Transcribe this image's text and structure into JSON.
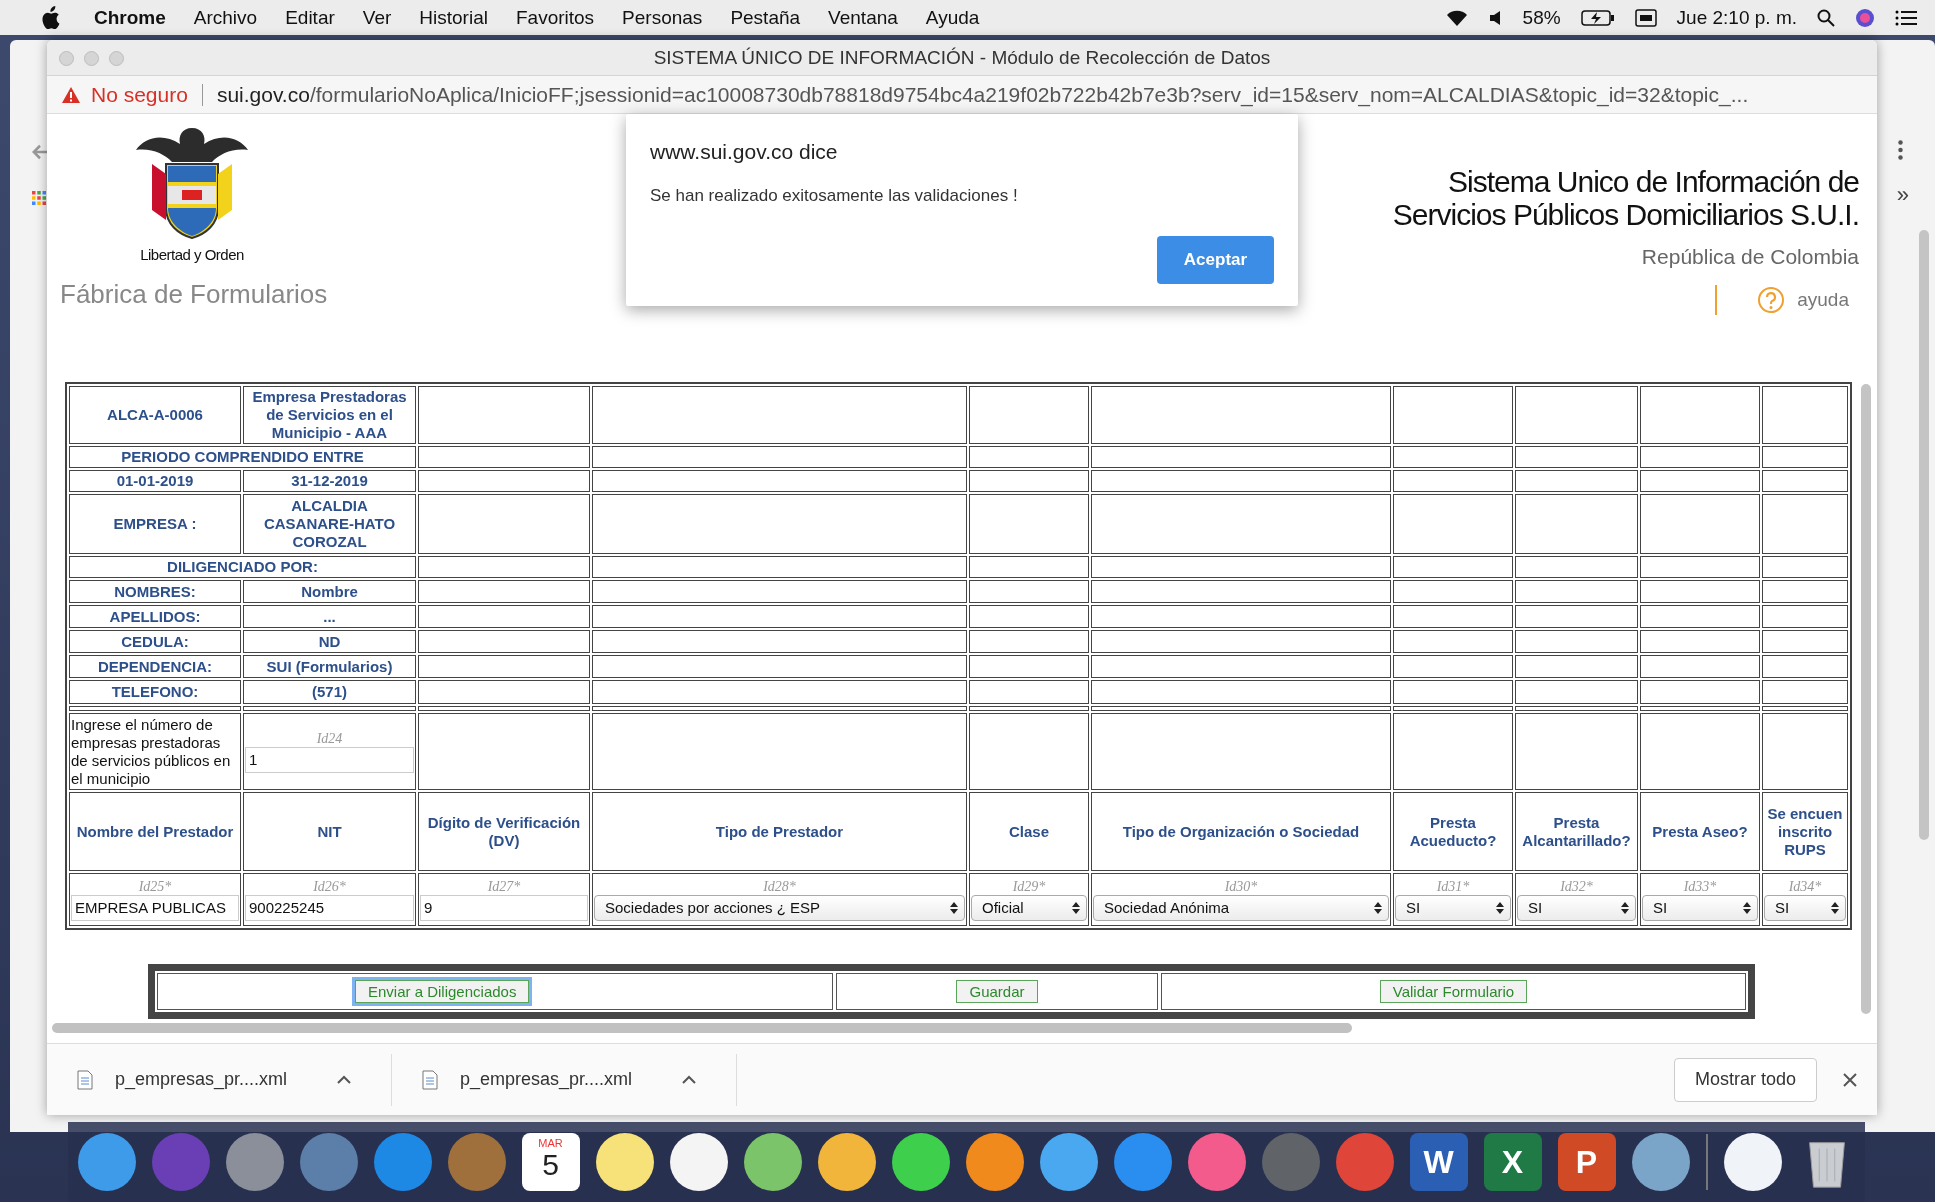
{
  "menu_bar": {
    "app": "Chrome",
    "menus": [
      "Archivo",
      "Editar",
      "Ver",
      "Historial",
      "Favoritos",
      "Personas",
      "Pestaña",
      "Ventana",
      "Ayuda"
    ],
    "battery": "58%",
    "clock": "Jue 2:10 p. m."
  },
  "window": {
    "title": "SISTEMA ÚNICO DE INFORMACIÓN - Módulo de Recolección de Datos"
  },
  "address_bar": {
    "security": "No seguro",
    "url_host": "sui.gov.co",
    "url_path": "/formularioNoAplica/InicioFF;jsessionid=ac10008730db78818d9754bc4a219f02b722b42b7e3b?serv_id=15&serv_nom=ALCALDIAS&topic_id=32&topic_..."
  },
  "background_window": {
    "overflow_label": "»"
  },
  "header": {
    "motto": "Libertad y Orden",
    "subtitle": "Fábrica de Formularios",
    "title_lines": [
      "Sistema Unico de Información de",
      "Servicios Públicos Domiciliarios S.U.I."
    ],
    "country": "República de Colombia",
    "help": "ayuda"
  },
  "info_rows": [
    {
      "kind": "pair",
      "cells": [
        "ALCA-A-0006",
        "Empresa Prestadoras de Servicios en el Municipio - AAA"
      ]
    },
    {
      "kind": "full",
      "cells": [
        "PERIODO COMPRENDIDO ENTRE"
      ]
    },
    {
      "kind": "pair",
      "cells": [
        "01-01-2019",
        "31-12-2019"
      ]
    },
    {
      "kind": "pair",
      "cells": [
        "EMPRESA :",
        "ALCALDIA CASANARE-HATO COROZAL"
      ]
    },
    {
      "kind": "full",
      "cells": [
        "DILIGENCIADO POR:"
      ]
    },
    {
      "kind": "pair",
      "cells": [
        "NOMBRES:",
        "Nombre"
      ]
    },
    {
      "kind": "pair",
      "cells": [
        "APELLIDOS:",
        "..."
      ]
    },
    {
      "kind": "pair",
      "cells": [
        "CEDULA:",
        "ND"
      ]
    },
    {
      "kind": "pair",
      "cells": [
        "DEPENDENCIA:",
        "SUI (Formularios)"
      ]
    },
    {
      "kind": "pair",
      "cells": [
        "TELEFONO:",
        "(571)"
      ]
    }
  ],
  "question": {
    "text": "Ingrese el número de empresas prestadoras de servicios públicos en el municipio",
    "field_id": "Id24",
    "value": "1"
  },
  "columns": [
    {
      "label": "Nombre del Prestador",
      "field_id": "Id25*",
      "kind": "input",
      "value": "EMPRESA PUBLICAS"
    },
    {
      "label": "NIT",
      "field_id": "Id26*",
      "kind": "input",
      "value": "900225245"
    },
    {
      "label": "Dígito de Verificación (DV)",
      "field_id": "Id27*",
      "kind": "input",
      "value": "9"
    },
    {
      "label": "Tipo de Prestador",
      "field_id": "Id28*",
      "kind": "select",
      "value": "Sociedades por acciones ¿ ESP"
    },
    {
      "label": "Clase",
      "field_id": "Id29*",
      "kind": "select",
      "value": "Oficial"
    },
    {
      "label": "Tipo de Organización o Sociedad",
      "field_id": "Id30*",
      "kind": "select",
      "value": "Sociedad Anónima"
    },
    {
      "label": "Presta Acueducto?",
      "field_id": "Id31*",
      "kind": "select",
      "value": "SI"
    },
    {
      "label": "Presta Alcantarillado?",
      "field_id": "Id32*",
      "kind": "select",
      "value": "SI"
    },
    {
      "label": "Presta Aseo?",
      "field_id": "Id33*",
      "kind": "select",
      "value": "SI"
    },
    {
      "label": "Se encuen inscrito RUPS",
      "field_id": "Id34*",
      "kind": "select",
      "value": "SI"
    }
  ],
  "buttons": [
    {
      "label": "Enviar a Diligenciados",
      "focused": true
    },
    {
      "label": "Guardar",
      "focused": false
    },
    {
      "label": "Validar Formulario",
      "focused": false
    }
  ],
  "dialog": {
    "title": "www.sui.gov.co dice",
    "message": "Se han realizado exitosamente las validaciones !",
    "button": "Aceptar"
  },
  "downloads": {
    "items": [
      {
        "name": "p_empresas_pr....xml"
      },
      {
        "name": "p_empresas_pr....xml"
      }
    ],
    "show_all": "Mostrar todo"
  },
  "dock": [
    {
      "kind": "plain",
      "color": "#3d9be9"
    },
    {
      "kind": "plain",
      "color": "#6a3fb5"
    },
    {
      "kind": "plain",
      "color": "#8a8f99"
    },
    {
      "kind": "plain",
      "color": "#5b7fa8"
    },
    {
      "kind": "plain",
      "color": "#1e88e5"
    },
    {
      "kind": "plain",
      "color": "#a0703c"
    },
    {
      "kind": "calendar",
      "color": "#ffffff",
      "month": "MAR",
      "day": "5"
    },
    {
      "kind": "plain",
      "color": "#f7e27a"
    },
    {
      "kind": "plain",
      "color": "#f4f4f4"
    },
    {
      "kind": "plain",
      "color": "#7cc46a"
    },
    {
      "kind": "plain",
      "color": "#f2b53c"
    },
    {
      "kind": "plain",
      "color": "#3ecf4c"
    },
    {
      "kind": "plain",
      "color": "#f08a1c"
    },
    {
      "kind": "plain",
      "color": "#4aa8f0"
    },
    {
      "kind": "plain",
      "color": "#2a8df0"
    },
    {
      "kind": "plain",
      "color": "#f25b8c"
    },
    {
      "kind": "plain",
      "color": "#606468"
    },
    {
      "kind": "plain",
      "color": "#e0453a"
    },
    {
      "kind": "letter",
      "color": "#2b5fb4",
      "letter": "W"
    },
    {
      "kind": "letter",
      "color": "#1f7a45",
      "letter": "X"
    },
    {
      "kind": "letter",
      "color": "#d04a25",
      "letter": "P"
    },
    {
      "kind": "plain",
      "color": "#7aa4c8"
    },
    {
      "kind": "separator",
      "color": "#777777"
    },
    {
      "kind": "plain",
      "color": "#f0f3f7"
    },
    {
      "kind": "trash",
      "color": "#c9ccd0"
    }
  ]
}
